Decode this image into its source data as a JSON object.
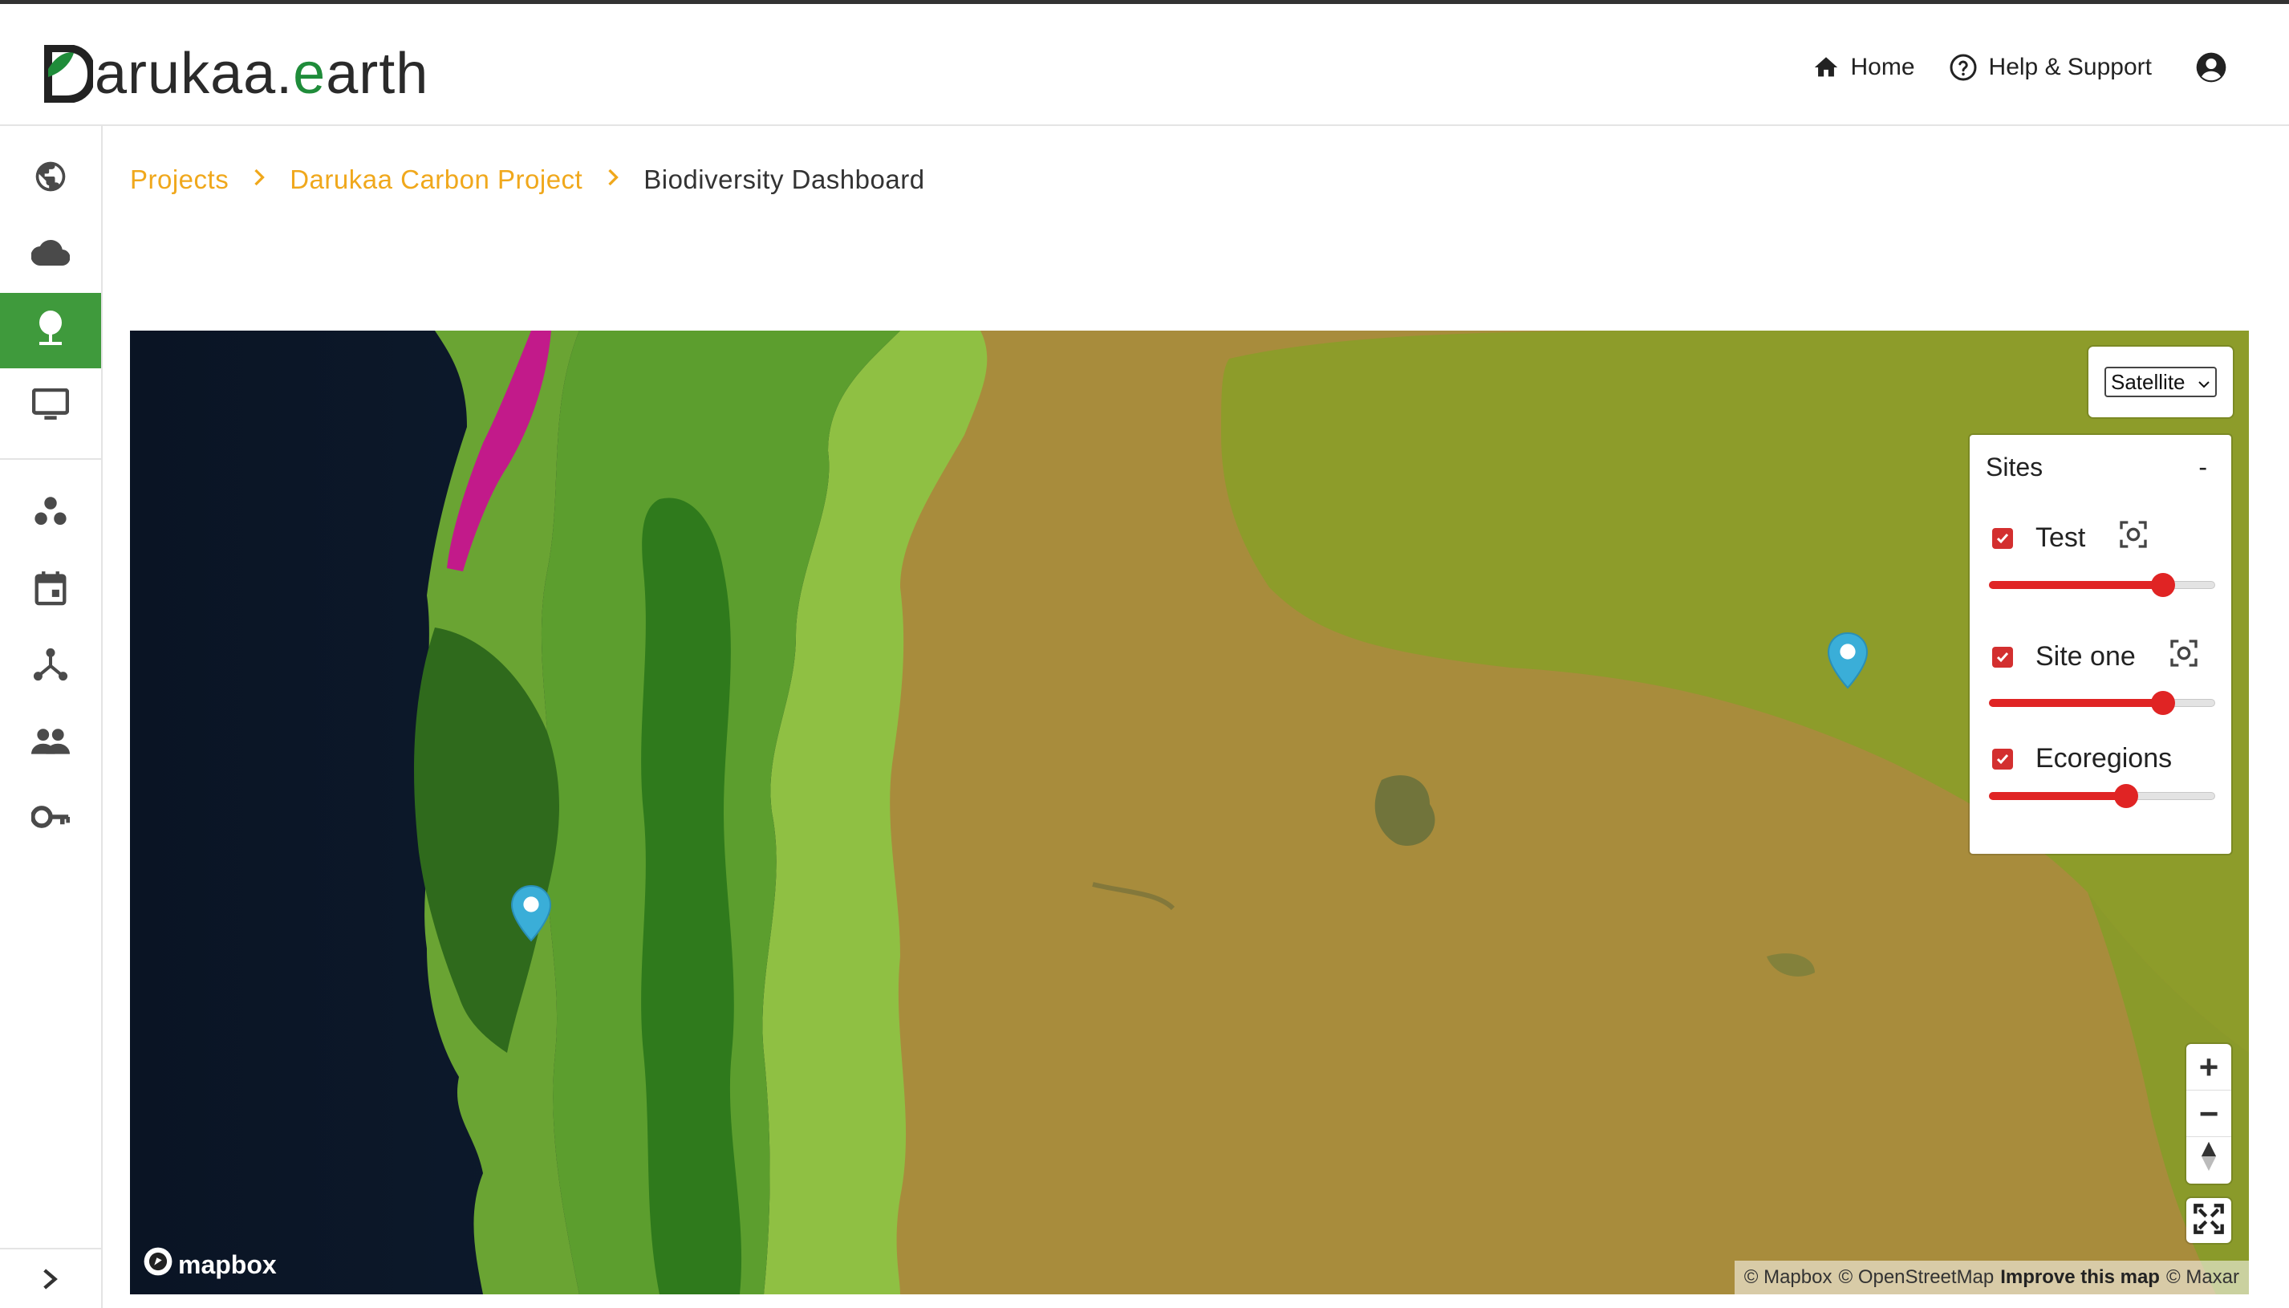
{
  "header": {
    "logo_text": "arukaa.",
    "logo_text_end": "arth",
    "nav": [
      {
        "label": "Home",
        "icon": "home-icon"
      },
      {
        "label": "Help & Support",
        "icon": "help-circle-icon"
      },
      {
        "label": "",
        "icon": "account-circle-icon"
      }
    ]
  },
  "sidebar": {
    "items": [
      {
        "icon": "globe-icon"
      },
      {
        "icon": "cloud-icon"
      },
      {
        "icon": "tree-icon",
        "active": true
      },
      {
        "icon": "monitor-icon"
      },
      {
        "icon": "bubbles-icon"
      },
      {
        "icon": "calendar-icon"
      },
      {
        "icon": "network-icon"
      },
      {
        "icon": "people-icon"
      },
      {
        "icon": "key-icon"
      }
    ],
    "toggle_icon": "chevron-right-icon"
  },
  "breadcrumb": {
    "items": [
      "Projects",
      "Darukaa Carbon Project"
    ],
    "current": "Biodiversity Dashboard"
  },
  "map": {
    "style_select": {
      "value": "Satellite"
    },
    "layers_panel": {
      "title": "Sites",
      "collapse_label": "-",
      "layers": [
        {
          "label": "Test",
          "checked": true,
          "has_focus_button": true,
          "opacity": 0.8
        },
        {
          "label": "Site one",
          "checked": true,
          "has_focus_button": true,
          "opacity": 0.8
        },
        {
          "label": "Ecoregions",
          "checked": true,
          "has_focus_button": false,
          "opacity": 0.62
        }
      ]
    },
    "zoom": {
      "in": "+",
      "out": "−"
    },
    "logo": "mapbox",
    "attribution": {
      "mapbox": "© Mapbox",
      "osm": "© OpenStreetMap",
      "improve": "Improve this map",
      "maxar": "© Maxar"
    },
    "colors": {
      "accent": "#f0a81c",
      "active_nav": "#3f9a3c",
      "slider": "#e02424",
      "pin": "#3aaed8"
    }
  }
}
